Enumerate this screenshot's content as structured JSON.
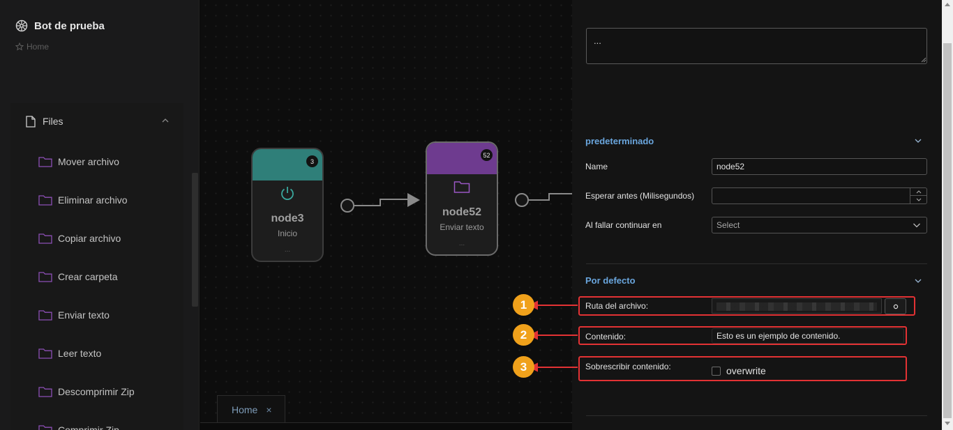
{
  "sidebar": {
    "title": "Bot de prueba",
    "breadcrumb": "Home",
    "menu_header": "Files",
    "items": [
      "Mover archivo",
      "Eliminar archivo",
      "Copiar archivo",
      "Crear carpeta",
      "Enviar texto",
      "Leer texto",
      "Descomprimir Zip",
      "Comprimir Zip"
    ]
  },
  "canvas": {
    "nodes": [
      {
        "name": "node3",
        "subtitle": "Inicio",
        "badge": "3",
        "more": "...",
        "color": "#2f7f79",
        "icon": "power-icon"
      },
      {
        "name": "node52",
        "subtitle": "Enviar texto",
        "badge": "52",
        "more": "...",
        "color": "#6e3b8f",
        "icon": "folder-icon"
      }
    ],
    "tab": {
      "label": "Home",
      "close": "×"
    }
  },
  "panel": {
    "textarea_value": "...",
    "section1": {
      "title": "predeterminado",
      "fields": [
        {
          "label": "Name",
          "value": "node52"
        },
        {
          "label": "Esperar antes (Milisegundos)",
          "value": ""
        },
        {
          "label": "Al fallar continuar en",
          "value": "Select"
        }
      ]
    },
    "section2": {
      "title": "Por defecto",
      "path_label": "Ruta del archivo:",
      "content_label": "Contenido:",
      "content_value": "Esto es un ejemplo de contenido.",
      "overwrite_label": "Sobrescribir contenido:",
      "checkbox_label": "overwrite"
    }
  },
  "annotations": [
    "1",
    "2",
    "3"
  ],
  "colors": {
    "accent_blue": "#6aa6de",
    "annotation_red": "#e33234",
    "marker_orange": "#f0a11b"
  }
}
